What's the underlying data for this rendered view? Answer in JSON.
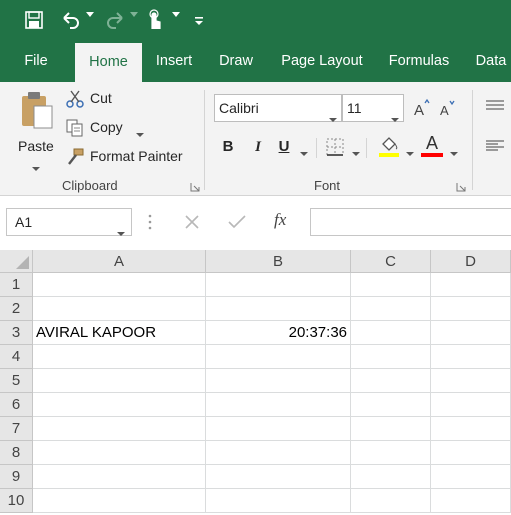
{
  "accent_color": "#217346",
  "quick_access": {
    "icons": [
      "save-icon",
      "undo-icon",
      "redo-icon",
      "touch-mode-icon",
      "customize-icon"
    ]
  },
  "tabs": [
    {
      "label": "File"
    },
    {
      "label": "Home",
      "active": true
    },
    {
      "label": "Insert"
    },
    {
      "label": "Draw"
    },
    {
      "label": "Page Layout"
    },
    {
      "label": "Formulas"
    },
    {
      "label": "Data"
    }
  ],
  "clipboard": {
    "paste_label": "Paste",
    "cut_label": "Cut",
    "copy_label": "Copy",
    "format_painter_label": "Format Painter",
    "group_label": "Clipboard"
  },
  "font": {
    "name": "Calibri",
    "size": "11",
    "bold_label": "B",
    "italic_label": "I",
    "underline_label": "U",
    "font_color_label": "A",
    "highlight_color": "#ffff00",
    "font_color": "#ff0000",
    "group_label": "Font"
  },
  "formula_bar": {
    "name_box": "A1",
    "fx_label": "fx",
    "value": ""
  },
  "sheet": {
    "columns": [
      "A",
      "B",
      "C",
      "D"
    ],
    "rows": [
      "1",
      "2",
      "3",
      "4",
      "5",
      "6",
      "7",
      "8",
      "9",
      "10"
    ],
    "cells": {
      "A3": "AVIRAL KAPOOR",
      "B3": "20:37:36"
    }
  }
}
